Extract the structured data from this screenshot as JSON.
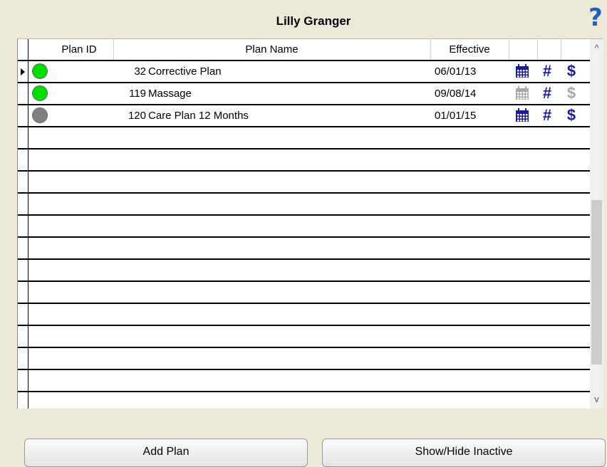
{
  "header": {
    "title": "Lilly Granger",
    "help_label": "?"
  },
  "table": {
    "columns": {
      "plan_id": "Plan ID",
      "plan_name": "Plan Name",
      "effective": "Effective"
    },
    "rows": [
      {
        "plan_id": "32",
        "plan_name": "Corrective Plan",
        "effective": "06/01/13",
        "status_color": "#00dd00",
        "calendar_active": true,
        "hash_active": true,
        "dollar_active": true,
        "selected": true
      },
      {
        "plan_id": "119",
        "plan_name": "Massage",
        "effective": "09/08/14",
        "status_color": "#00dd00",
        "calendar_active": false,
        "hash_active": true,
        "dollar_active": false,
        "selected": false
      },
      {
        "plan_id": "120",
        "plan_name": "Care Plan 12 Months",
        "effective": "01/01/15",
        "status_color": "#808080",
        "calendar_active": true,
        "hash_active": true,
        "dollar_active": true,
        "selected": false
      }
    ],
    "icons": {
      "calendar": "calendar-icon",
      "hash": "#",
      "dollar": "$"
    },
    "colors": {
      "active_icon": "#1a1aa0",
      "inactive_icon": "#a8a8a8"
    }
  },
  "buttons": {
    "add_plan": "Add Plan",
    "show_hide_inactive": "Show/Hide Inactive"
  },
  "scrollbar": {
    "up_icon": "chevron-up-icon",
    "down_icon": "chevron-down-icon"
  }
}
